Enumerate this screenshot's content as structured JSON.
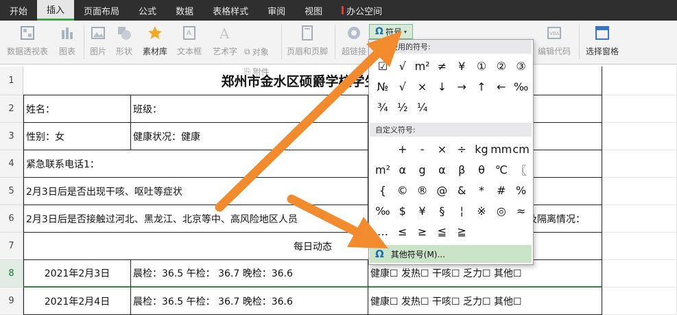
{
  "tabs": [
    "开始",
    "插入",
    "页面布局",
    "公式",
    "数据",
    "表格样式",
    "审阅",
    "视图",
    "办公空间"
  ],
  "ribbon": {
    "pivot": "数据透视表",
    "chart": "图表",
    "picture": "图片",
    "shape": "形状",
    "library": "素材库",
    "textbox": "文本框",
    "art": "艺术字",
    "object": "对象",
    "attachment": "附件",
    "header_footer": "页眉和页脚",
    "hyperlink": "超链接",
    "symbol": "符号",
    "edit_code": "编辑代码",
    "selection_pane": "选择窗格"
  },
  "symbol_popup": {
    "recent_title": "近期使用的符号:",
    "recent": [
      "☑",
      "√",
      "m²",
      "≠",
      "¥",
      "①",
      "②",
      "③",
      "№",
      "√",
      "×",
      "↓",
      "→",
      "↑",
      "←",
      "‰",
      "¾",
      "½",
      "¼"
    ],
    "custom_title": "自定义符号:",
    "custom": [
      "",
      "+",
      "-",
      "×",
      "÷",
      "kg",
      "mm",
      "cm",
      "m²",
      "α",
      "g",
      "α",
      "β",
      "θ",
      "℃",
      "〖",
      "{",
      "©",
      "®",
      "@",
      "&",
      "*",
      "#",
      "%",
      "‰",
      "$",
      "¥",
      "§",
      "¦",
      "※",
      "◎",
      "≈",
      "…",
      "≤",
      "≥",
      "≦",
      "≧"
    ],
    "more": "其他符号(M)..."
  },
  "sheet": {
    "rows": [
      "1",
      "2",
      "3",
      "4",
      "5",
      "6",
      "7",
      "8",
      "9"
    ],
    "title": "郑州市金水区硕爵学校学生寒假",
    "name": "姓名：",
    "class": "班级：",
    "gender": "性别：女",
    "health": "健康状况：健康",
    "contact": "紧急联系电话1：",
    "q1": "2月3日后是否出现干咳、呕吐等症状",
    "q2": "2月3日后是否接触过河北、黑龙江、北京等中、高风险地区人员",
    "q2_right": "及隔离情况：",
    "daily": "每日动态",
    "r8_date": "2021年2月3日",
    "r8_checks": "晨检：36.5      午检： 36.7     晚检：36.6",
    "r8_status": "健康☐  发热☐   干咳☐   乏力☐    其他☐",
    "r9_date": "2021年2月4日",
    "r9_checks": "晨检：36.5      午检： 36.7     晚检：36.6",
    "r9_status": "健康☐  发热☐   干咳☐   乏力☐    其他☐"
  },
  "colors": {
    "accent_arrow": "#f28a2e",
    "tab_active_bar": "#3da34d",
    "more_highlight": "#c9e4c6"
  }
}
